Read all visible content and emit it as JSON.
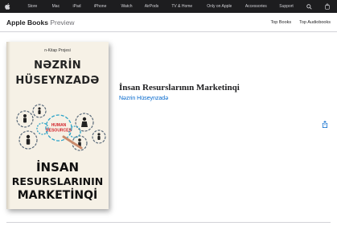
{
  "globalnav": {
    "items": [
      "Store",
      "Mac",
      "iPad",
      "iPhone",
      "Watch",
      "AirPods",
      "TV & Home",
      "Only on Apple",
      "Accessories",
      "Support"
    ]
  },
  "localnav": {
    "brand": "Apple Books",
    "preview": "Preview",
    "links": [
      "Top Books",
      "Top Audiobooks"
    ]
  },
  "book": {
    "title": "İnsan Resurslarının Marketinqi",
    "author": "Nəzrin Hüseynzadə"
  },
  "cover": {
    "series": "n-Kitap Projesi",
    "author_line1": "NƏZRİN",
    "author_line2": "HÜSEYNZADƏ",
    "badge_line1": "HUMAN",
    "badge_line2": "RESOURCES",
    "title_line1": "İNSAN",
    "title_line2": "RESURSLARININ",
    "title_line3": "MARKETİNQİ"
  },
  "colors": {
    "nav_bg": "#1d1d1f",
    "link": "#0066cc",
    "cover_bg": "#f6f1e6",
    "accent_red": "#d2232a"
  },
  "icons": {
    "logo": "apple-logo-icon",
    "search": "search-icon",
    "bag": "bag-icon",
    "share": "share-icon"
  }
}
